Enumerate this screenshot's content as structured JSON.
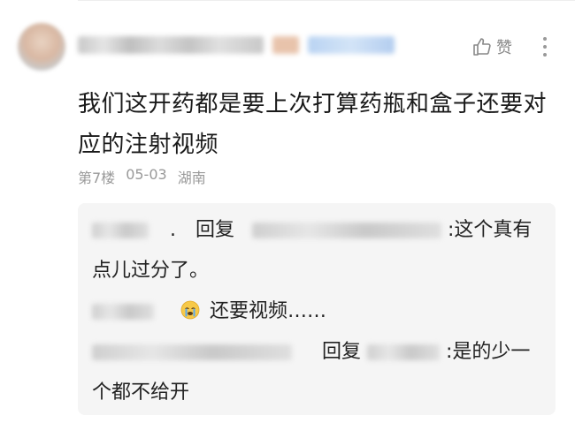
{
  "comment": {
    "text": "我们这开药都是要上次打算药瓶和盒子还要对应的注射视频",
    "like_label": "赞",
    "floor": "第7楼",
    "date": "05-03",
    "location": "湖南"
  },
  "replies": [
    {
      "dot": ".",
      "reply_word": "回复",
      "content": ":这个真有点儿过分了。"
    },
    {
      "content": "还要视频……",
      "emoji": "crying-face-emoji"
    },
    {
      "reply_word": "回复",
      "content": ":是的少一个都不给开"
    }
  ],
  "icons": {
    "like": "thumbs-up-icon",
    "more": "vertical-ellipsis-icon"
  },
  "colors": {
    "meta_text": "#999999",
    "reply_bg": "#f5f5f5",
    "main_text": "#1a1a1a"
  }
}
